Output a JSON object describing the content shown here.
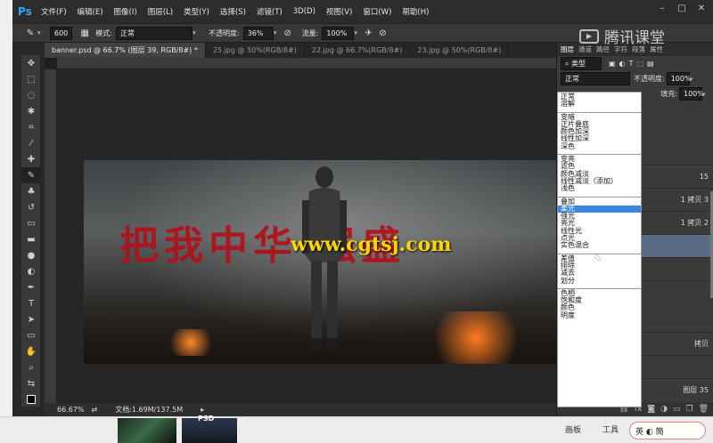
{
  "menubar": {
    "logo": "Ps",
    "items": [
      "文件(F)",
      "编辑(E)",
      "图像(I)",
      "图层(L)",
      "类型(Y)",
      "选择(S)",
      "滤镜(T)",
      "3D(D)",
      "视图(V)",
      "窗口(W)",
      "帮助(H)"
    ]
  },
  "options": {
    "brush_size": "600",
    "mode_label": "模式:",
    "mode_value": "正常",
    "opacity_label": "不透明度:",
    "opacity_value": "36%",
    "flow_label": "流量:",
    "flow_value": "100%"
  },
  "tabs": [
    {
      "label": "banner.psd @ 66.7% (图层 39, RGB/8#) *",
      "active": true
    },
    {
      "label": "25.jpg @ 50%(RGB/8#)",
      "active": false
    },
    {
      "label": "22.jpg @ 66.7%(RGB/8#)",
      "active": false
    },
    {
      "label": "23.jpg @ 50%(RGB/8#)",
      "active": false
    }
  ],
  "canvas": {
    "red_text": "把我中华 强盛",
    "watermark": "www.cgtsj.com"
  },
  "status": {
    "zoom": "66.67%",
    "doc": "文档:1.69M/137.5M"
  },
  "panel": {
    "tabs": [
      "图层",
      "通道",
      "路径",
      "字符",
      "段落",
      "属性"
    ],
    "kind_label": "类型",
    "blend_value": "正常",
    "opacity_label": "不透明度:",
    "opacity_value": "100%",
    "fill_label": "填充:",
    "fill_value": "100%",
    "layers": [
      {
        "name": "15",
        "selected": false
      },
      {
        "name": "1 拷贝 3",
        "selected": false
      },
      {
        "name": "1 拷贝 2",
        "selected": false
      },
      {
        "name": "",
        "selected": true
      },
      {
        "name": "",
        "selected": false
      },
      {
        "name": "",
        "selected": false
      },
      {
        "name": "拷贝",
        "selected": false
      },
      {
        "name": "",
        "selected": false
      },
      {
        "name": "图层 35",
        "selected": false
      }
    ]
  },
  "blend_modes": [
    [
      "正常",
      "溶解"
    ],
    [
      "变暗",
      "正片叠底",
      "颜色加深",
      "线性加深",
      "深色"
    ],
    [
      "变亮",
      "滤色",
      "颜色减淡",
      "线性减淡（添加）",
      "浅色"
    ],
    [
      "叠加",
      "柔光",
      "强光",
      "亮光",
      "线性光",
      "点光",
      "实色混合"
    ],
    [
      "差值",
      "排除",
      "减去",
      "划分"
    ],
    [
      "色相",
      "饱和度",
      "颜色",
      "明度"
    ]
  ],
  "highlighted_mode": "柔光",
  "brand": "腾讯课堂",
  "taskbar": {
    "thumb_label": "PSD",
    "btn1": "画板",
    "btn2": "工具",
    "ime": "英 ◐ 簡"
  }
}
